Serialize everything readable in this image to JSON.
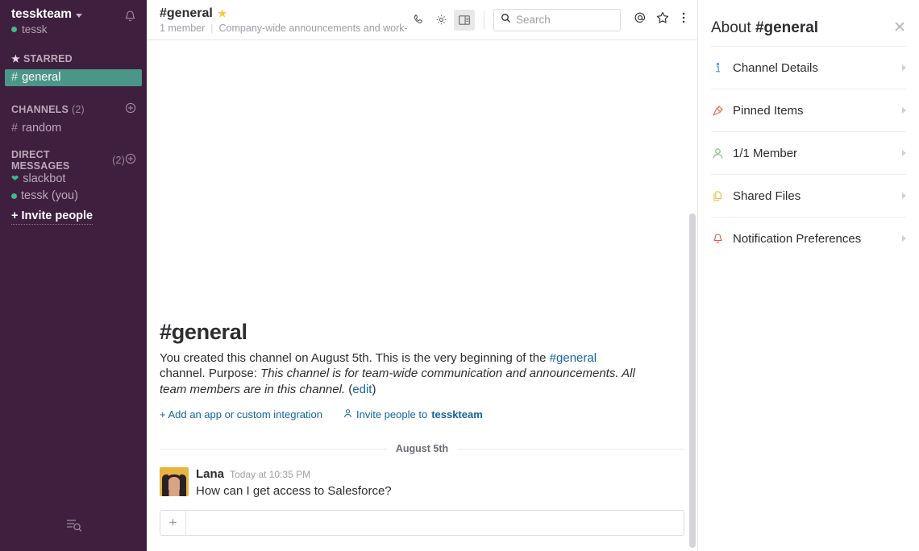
{
  "sidebar": {
    "team_name": "tesskteam",
    "team_user": "tessk",
    "bell_icon": "bell-icon",
    "caret_icon": "chevron-down-icon",
    "starred": {
      "label": "STARRED",
      "star_icon": "star-icon",
      "items": [
        {
          "prefix": "#",
          "label": "general",
          "active": true
        }
      ]
    },
    "channels": {
      "label": "CHANNELS",
      "count": "(2)",
      "add_icon": "plus-circle-icon",
      "items": [
        {
          "prefix": "#",
          "label": "random"
        }
      ]
    },
    "direct_messages": {
      "label": "DIRECT MESSAGES",
      "count": "(2)",
      "add_icon": "plus-circle-icon",
      "items": [
        {
          "icon": "heart-icon",
          "label": "slackbot"
        },
        {
          "icon": "presence-dot",
          "label": "tessk (you)"
        }
      ]
    },
    "invite_label": "+ Invite people",
    "bottom_icon": "list-search-icon"
  },
  "header": {
    "channel_title": "#general",
    "star_icon": "star-filled-icon",
    "member_count": "1 member",
    "topic": "Company-wide announcements and work-based matters",
    "tools": [
      {
        "name": "call-icon",
        "active": false
      },
      {
        "name": "gear-icon",
        "active": false
      },
      {
        "name": "panel-toggle-icon",
        "active": true
      }
    ],
    "search": {
      "placeholder": "Search",
      "value": "",
      "icon": "search-icon"
    },
    "right_icons": [
      {
        "name": "mention-icon"
      },
      {
        "name": "star-outline-icon"
      },
      {
        "name": "kebab-menu-icon"
      }
    ]
  },
  "intro": {
    "title": "#general",
    "created_text_1": "You created this channel on August 5th. This is the very beginning of the ",
    "created_link": "#general",
    "created_text_2": " channel.",
    "purpose_label": "Purpose:",
    "purpose_text": "This channel is for team-wide communication and announcements. All team members are in this channel.",
    "edit_link": "edit",
    "action_add_app": "+ Add an app or custom integration",
    "action_invite_prefix": "Invite people to ",
    "action_invite_team": "tesskteam",
    "invite_icon": "person-icon"
  },
  "messages": {
    "date_divider": "August 5th",
    "items": [
      {
        "author": "Lana",
        "time": "Today at 10:35 PM",
        "text": "How can I get access to Salesforce?",
        "avatar": "avatar-lana"
      }
    ]
  },
  "composer": {
    "placeholder": "",
    "value": "",
    "plus_icon": "plus-icon"
  },
  "right_panel": {
    "title_prefix": "About",
    "title_channel": "#general",
    "close_icon": "close-icon",
    "items": [
      {
        "label": "Channel Details",
        "icon": "info-icon",
        "icon_color": "#4a90d9"
      },
      {
        "label": "Pinned Items",
        "icon": "pin-icon",
        "icon_color": "#e8715c"
      },
      {
        "label": "1/1 Member",
        "icon": "person-icon",
        "icon_color": "#7fbf7f",
        "count": "1",
        "total": "1",
        "noun": "Member"
      },
      {
        "label": "Shared Files",
        "icon": "files-icon",
        "icon_color": "#e8c24a"
      },
      {
        "label": "Notification  Preferences",
        "icon": "bell-icon",
        "icon_color": "#e05a46"
      }
    ]
  },
  "colors": {
    "sidebar_bg": "#3E1F3D",
    "active_channel": "#4C9689",
    "link": "#1264a3",
    "star": "#f7c948"
  }
}
